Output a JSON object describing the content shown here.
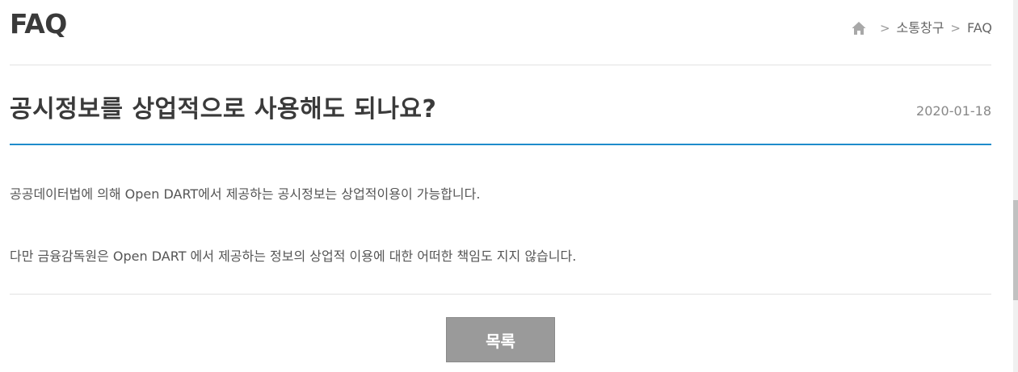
{
  "header": {
    "title": "FAQ",
    "breadcrumb": {
      "home_icon": "home-icon",
      "items": [
        "소통창구",
        "FAQ"
      ]
    }
  },
  "post": {
    "title": "공시정보를 상업적으로 사용해도 되나요?",
    "date": "2020-01-18",
    "paragraphs": [
      "공공데이터법에 의해 Open DART에서 제공하는 공시정보는 상업적이용이 가능합니다.",
      "다만 금융감독원은 Open DART 에서 제공하는 정보의 상업적 이용에 대한 어떠한 책임도 지지 않습니다."
    ]
  },
  "actions": {
    "list_button_label": "목록"
  },
  "colors": {
    "accent": "#1f8ccb",
    "button_bg": "#9a9a9a"
  }
}
